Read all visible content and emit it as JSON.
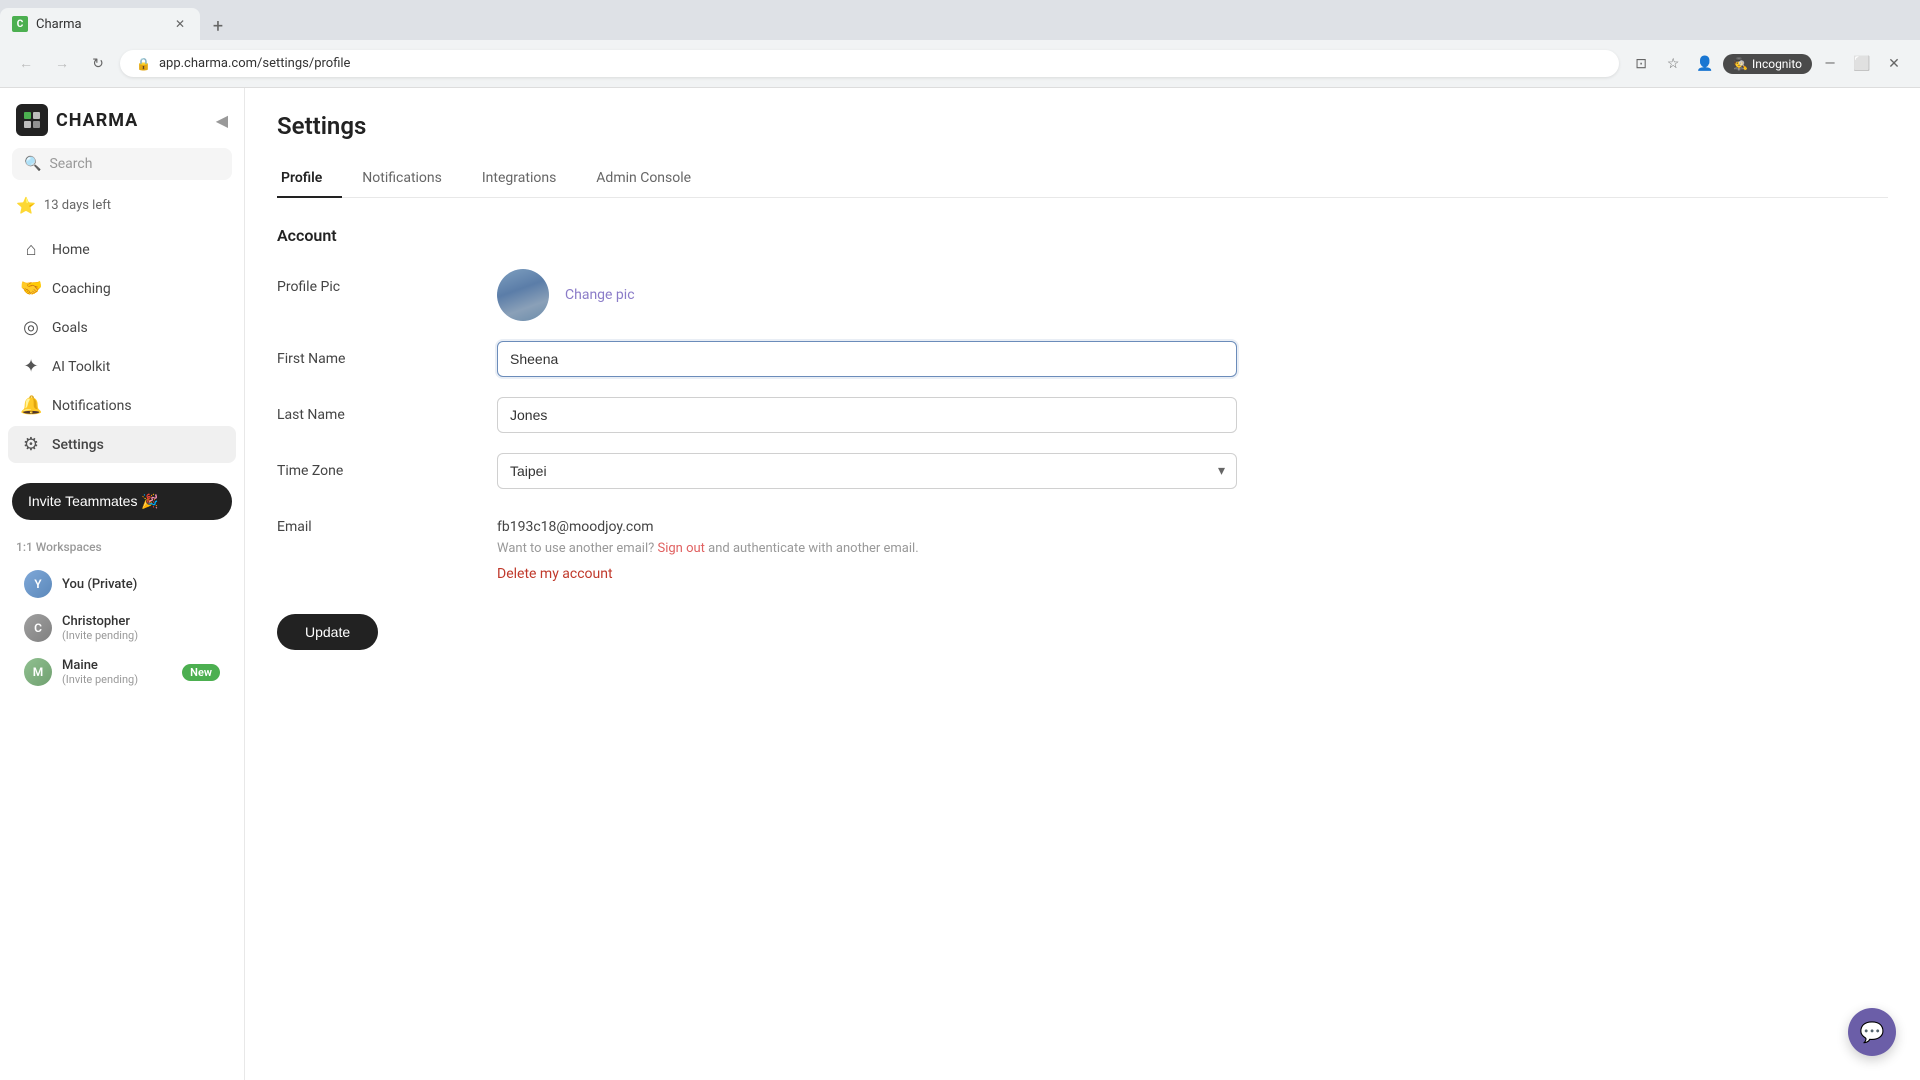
{
  "browser": {
    "tab_title": "Charma",
    "url": "app.charma.com/settings/profile",
    "incognito_label": "Incognito"
  },
  "sidebar": {
    "logo_text": "CHARMA",
    "search_placeholder": "Search",
    "trial_label": "13 days left",
    "nav_items": [
      {
        "id": "home",
        "label": "Home",
        "icon": "⌂"
      },
      {
        "id": "coaching",
        "label": "Coaching",
        "icon": "🤝"
      },
      {
        "id": "goals",
        "label": "Goals",
        "icon": "◎"
      },
      {
        "id": "ai-toolkit",
        "label": "AI Toolkit",
        "icon": "✦"
      },
      {
        "id": "notifications",
        "label": "Notifications",
        "icon": "🔔"
      },
      {
        "id": "settings",
        "label": "Settings",
        "icon": "⚙",
        "active": true
      }
    ],
    "invite_button_label": "Invite Teammates 🎉",
    "workspaces_section_label": "1:1 Workspaces",
    "workspaces": [
      {
        "id": "you",
        "name": "You (Private)",
        "sub": "",
        "avatar_initials": "Y",
        "avatar_class": "avatar-you"
      },
      {
        "id": "christopher",
        "name": "Christopher",
        "sub": "(Invite pending)",
        "avatar_initials": "C",
        "avatar_class": "avatar-chris"
      },
      {
        "id": "maine",
        "name": "Maine",
        "sub": "(Invite pending)",
        "badge": "New",
        "avatar_initials": "M",
        "avatar_class": "avatar-maine"
      }
    ]
  },
  "page": {
    "title": "Settings",
    "tabs": [
      {
        "id": "profile",
        "label": "Profile",
        "active": true
      },
      {
        "id": "notifications",
        "label": "Notifications",
        "active": false
      },
      {
        "id": "integrations",
        "label": "Integrations",
        "active": false
      },
      {
        "id": "admin-console",
        "label": "Admin Console",
        "active": false
      }
    ]
  },
  "account": {
    "section_title": "Account",
    "profile_pic_label": "Profile Pic",
    "change_pic_label": "Change pic",
    "first_name_label": "First Name",
    "first_name_value": "Sheena",
    "last_name_label": "Last Name",
    "last_name_value": "Jones",
    "time_zone_label": "Time Zone",
    "time_zone_value": "Taipei",
    "email_label": "Email",
    "email_value": "fb193c18@moodjoy.com",
    "email_note": "Want to use another email?",
    "sign_out_label": "Sign out",
    "email_note_suffix": "and authenticate with another email.",
    "delete_account_label": "Delete my account",
    "update_button_label": "Update"
  },
  "chat_fab": {
    "icon": "💬"
  }
}
